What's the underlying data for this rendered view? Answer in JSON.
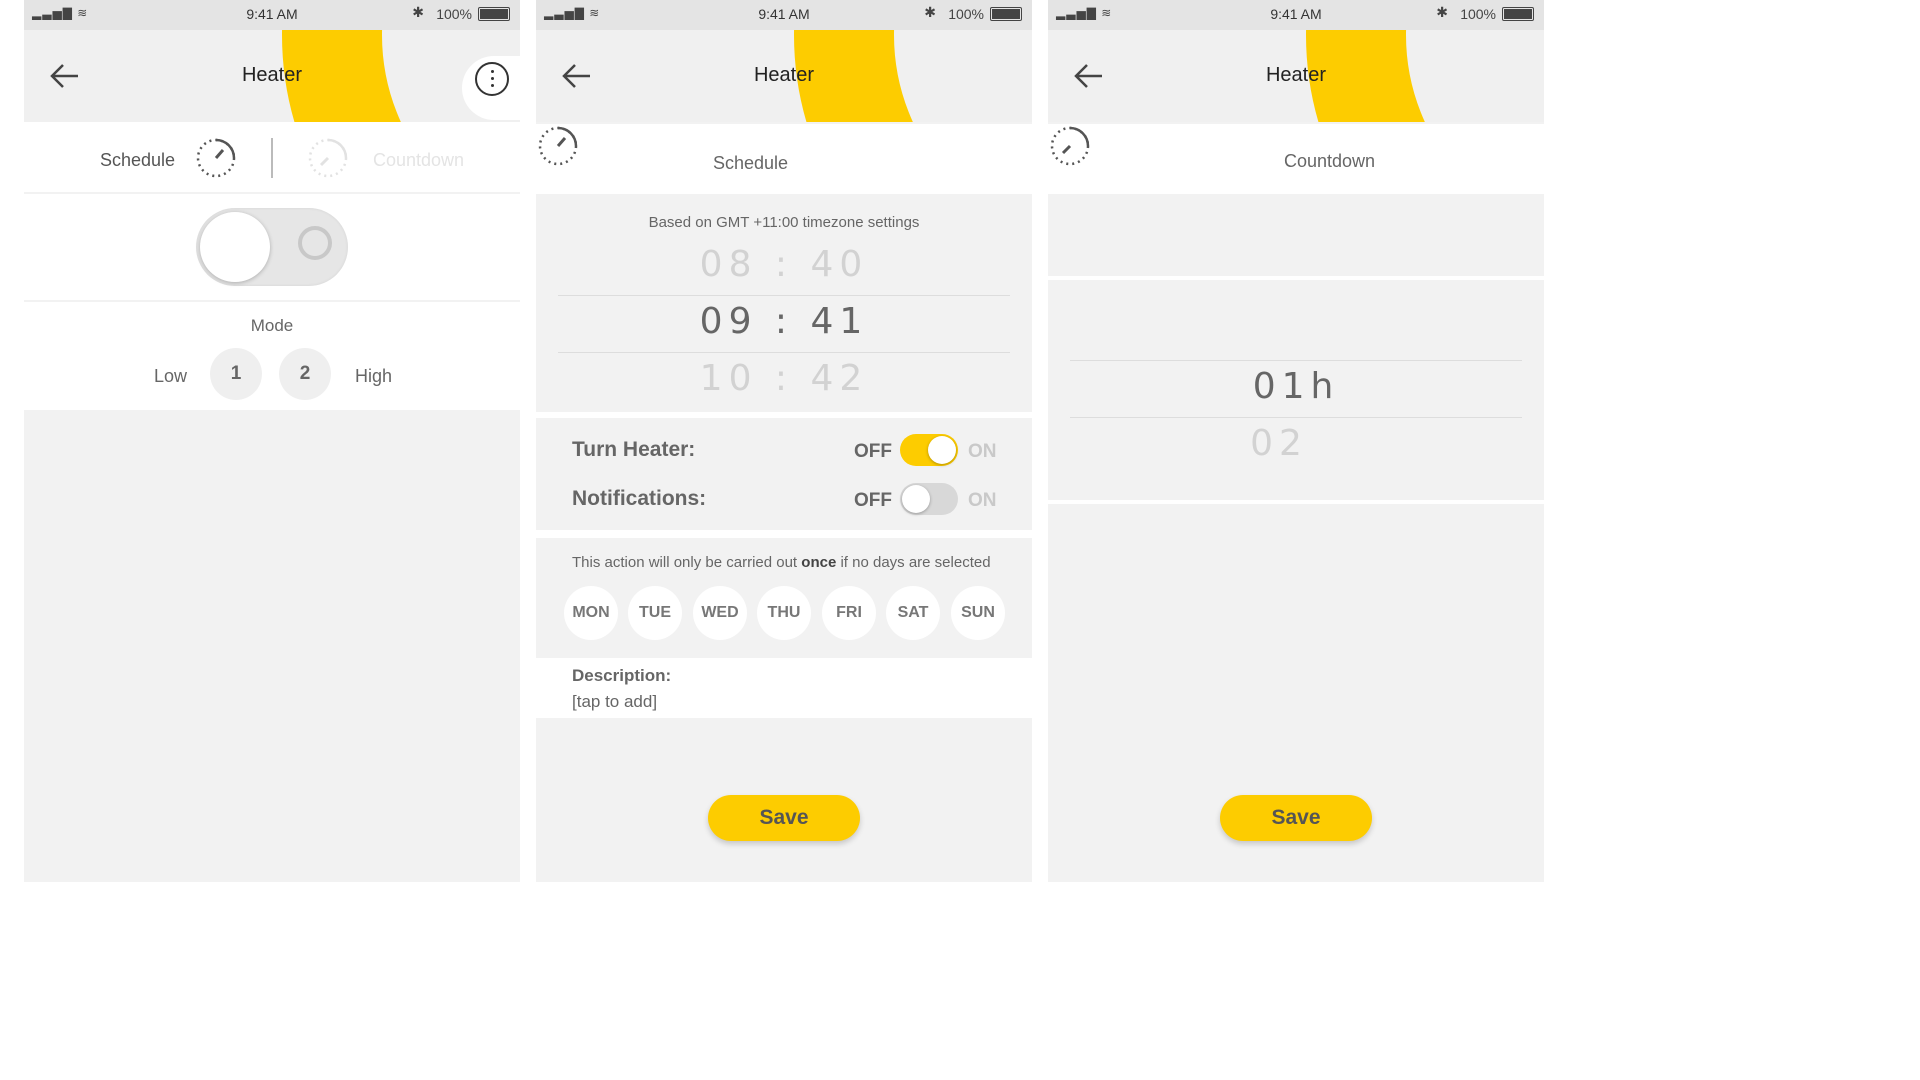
{
  "status": {
    "time": "9:41 AM",
    "battery": "100%"
  },
  "screen1": {
    "title": "Heater",
    "tabs": {
      "schedule": "Schedule",
      "countdown": "Countdown"
    },
    "mode": {
      "title": "Mode",
      "low": "Low",
      "high": "High",
      "options": [
        "1",
        "2"
      ]
    }
  },
  "screen2": {
    "title": "Heater",
    "tab": "Schedule",
    "timezone_note": "Based on GMT +11:00 timezone settings",
    "picker": {
      "prev": {
        "h": "08",
        "m": "40"
      },
      "current": {
        "h": "09",
        "m": "41"
      },
      "next": {
        "h": "10",
        "m": "42"
      }
    },
    "turn_heater": {
      "label": "Turn Heater:",
      "off": "OFF",
      "on": "ON",
      "state": "on"
    },
    "notifications": {
      "label": "Notifications:",
      "off": "OFF",
      "on": "ON",
      "state": "off"
    },
    "days_note_pre": "This action will only be carried out ",
    "days_note_bold": "once",
    "days_note_post": " if no days are selected",
    "days": [
      "MON",
      "TUE",
      "WED",
      "THU",
      "FRI",
      "SAT",
      "SUN"
    ],
    "description_label": "Description:",
    "description_value": "[tap to add]",
    "save": "Save"
  },
  "screen3": {
    "title": "Heater",
    "tab": "Countdown",
    "picker": {
      "current": "01h",
      "next": "02"
    },
    "save": "Save"
  },
  "colors": {
    "accent": "#fdcc00",
    "background": "#f2f2f2"
  }
}
